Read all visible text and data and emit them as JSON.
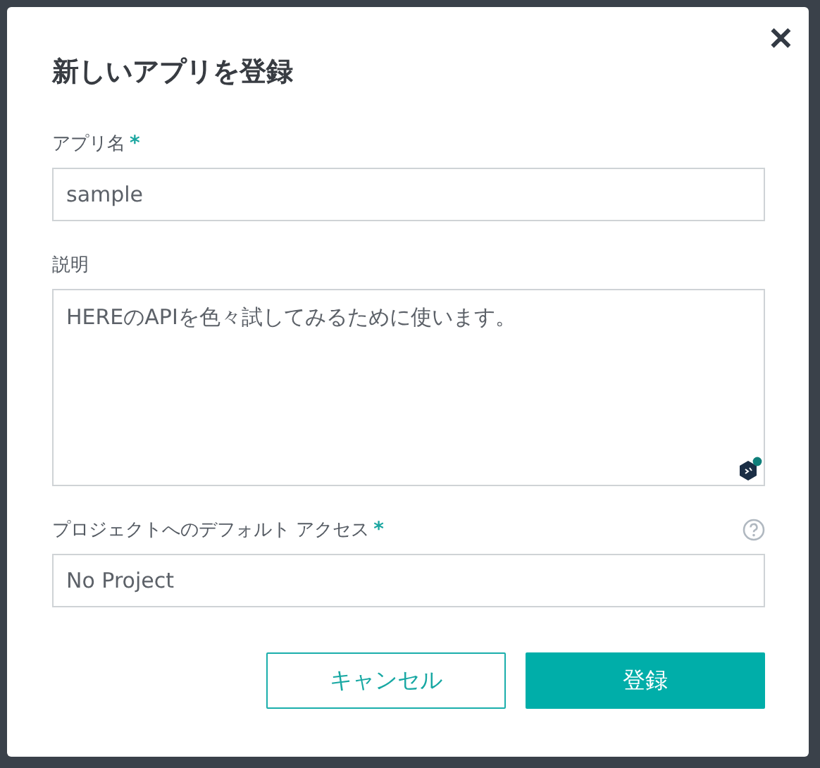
{
  "dialog": {
    "title": "新しいアプリを登録",
    "close": "✕",
    "required_mark": "*"
  },
  "fields": [
    {
      "kind": "input",
      "label": "アプリ名",
      "required": true,
      "help": false,
      "value": "sample"
    },
    {
      "kind": "textarea",
      "label": "説明",
      "required": false,
      "help": false,
      "value": "HEREのAPIを色々試してみるために使います。"
    },
    {
      "kind": "input",
      "label": "プロジェクトへのデフォルト アクセス",
      "required": true,
      "help": true,
      "value": "No Project"
    }
  ],
  "buttons": [
    {
      "kind": "secondary",
      "label": "キャンセル"
    },
    {
      "kind": "primary",
      "label": "登録"
    }
  ]
}
